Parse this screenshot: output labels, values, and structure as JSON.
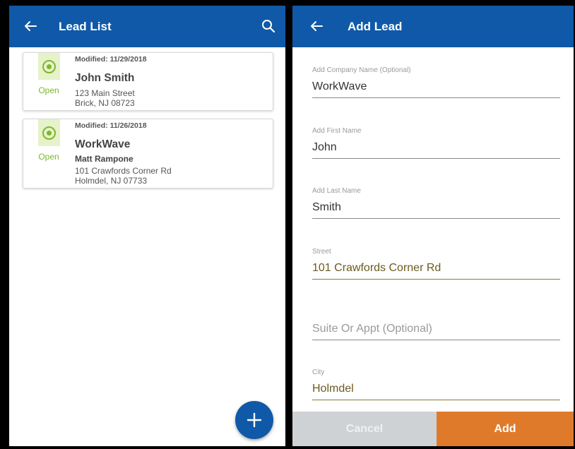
{
  "lead_list": {
    "title": "Lead List",
    "leads": [
      {
        "status": "Open",
        "modified": "Modified: 11/29/2018",
        "name": "John Smith",
        "contact": "",
        "address_line1": "123 Main Street",
        "address_line2": "Brick, NJ 08723"
      },
      {
        "status": "Open",
        "modified": "Modified: 11/26/2018",
        "name": "WorkWave",
        "contact": "Matt Rampone",
        "address_line1": "101 Crawfords Corner Rd",
        "address_line2": "Holmdel, NJ 07733"
      }
    ],
    "fab_icon": "plus-icon"
  },
  "add_lead": {
    "title": "Add Lead",
    "fields": {
      "company": {
        "label": "Add Company Name (Optional)",
        "value": "WorkWave"
      },
      "first_name": {
        "label": "Add First Name",
        "value": "John"
      },
      "last_name": {
        "label": "Add Last Name",
        "value": "Smith"
      },
      "street": {
        "label": "Street",
        "value": "101 Crawfords Corner Rd"
      },
      "suite": {
        "placeholder": "Suite Or Appt (Optional)"
      },
      "city": {
        "label": "City",
        "value": "Holmdel"
      }
    },
    "cancel_label": "Cancel",
    "add_label": "Add"
  },
  "colors": {
    "primary": "#0f59a8",
    "status_open": "#7cb82f",
    "accent_add": "#e07a2b",
    "cancel_disabled": "#cfd2d5"
  }
}
